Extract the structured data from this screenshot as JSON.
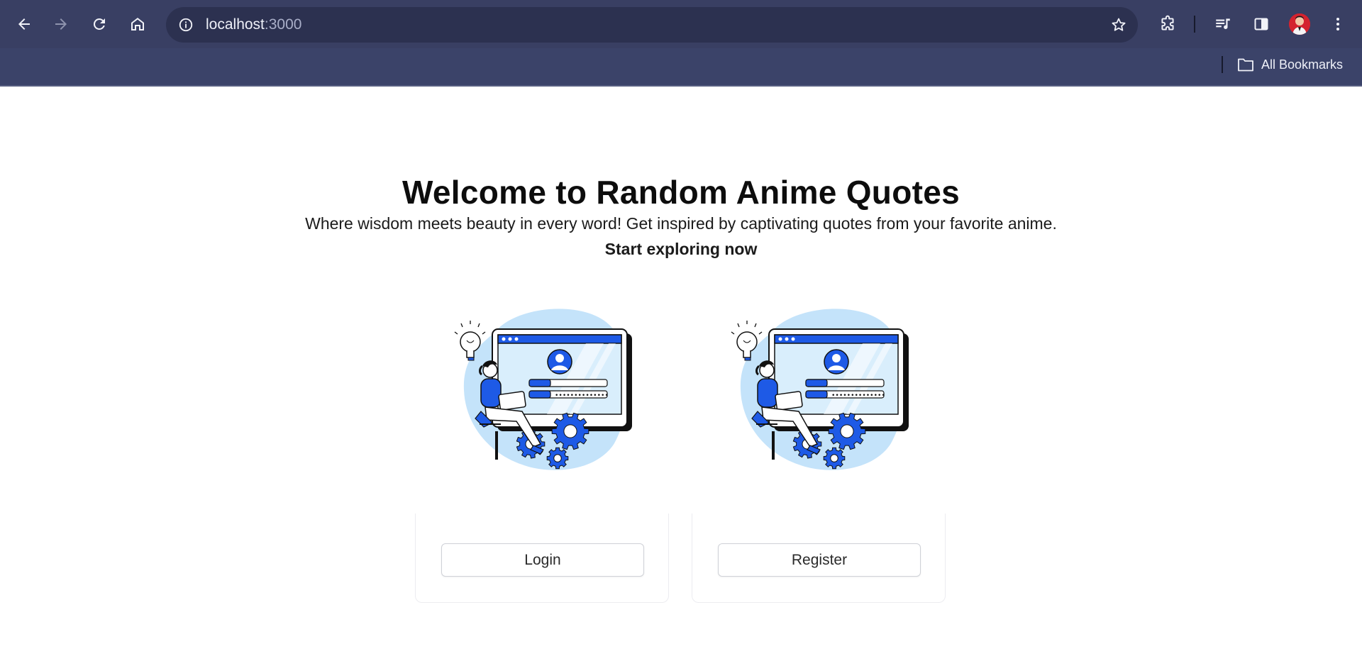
{
  "browser": {
    "url_host": "localhost",
    "url_port": ":3000",
    "bookmarks_label": "All Bookmarks"
  },
  "page": {
    "title": "Welcome to Random Anime Quotes",
    "subtitle": "Where wisdom meets beauty in every word! Get inspired by captivating quotes from your favorite anime.",
    "cta": "Start exploring now",
    "cards": [
      {
        "button_label": "Login"
      },
      {
        "button_label": "Register"
      }
    ]
  },
  "colors": {
    "chrome_bg": "#393f63",
    "omnibox_bg": "#2c3150",
    "accent_blue": "#1e5ae6",
    "light_blue": "#c4e3fa"
  },
  "icons": [
    "back-arrow-icon",
    "forward-arrow-icon",
    "reload-icon",
    "home-icon",
    "site-info-icon",
    "star-icon",
    "extensions-icon",
    "media-control-icon",
    "side-panel-icon",
    "profile-avatar",
    "more-menu-icon",
    "folder-icon"
  ]
}
